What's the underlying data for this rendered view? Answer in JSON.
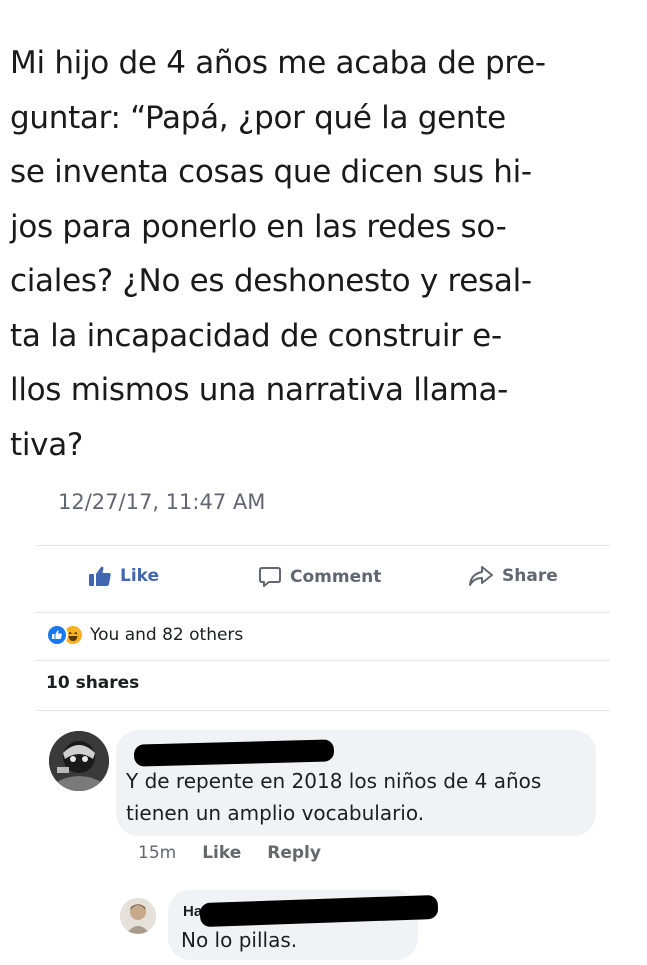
{
  "post": {
    "lines": [
      "Mi hijo de 4 años me acaba de pre-",
      "guntar: “Papá, ¿por qué la gente",
      "se inventa cosas que dicen sus hi-",
      "jos para ponerlo en las redes so-",
      "ciales? ¿No es deshonesto y resal-",
      "ta la incapacidad de construir e-",
      "llos mismos una narrativa llama-",
      "tiva?"
    ],
    "timestamp": "12/27/17, 11:47 AM"
  },
  "actions": {
    "like": "Like",
    "comment": "Comment",
    "share": "Share"
  },
  "reactions": {
    "summary": "You and 82 others",
    "icons": [
      "like-reaction-icon",
      "haha-reaction-icon"
    ]
  },
  "shares": "10 shares",
  "comments": [
    {
      "text_lines": [
        "Y de repente en 2018 los niños de 4 años",
        "tienen un amplio vocabulario."
      ],
      "time": "15m",
      "like": "Like",
      "reply": "Reply"
    },
    {
      "name_visible": "Ha",
      "text": "No lo pillas."
    }
  ],
  "colors": {
    "like_blue": "#4267b2",
    "bubble": "#f0f2f5",
    "meta_gray": "#616770"
  }
}
